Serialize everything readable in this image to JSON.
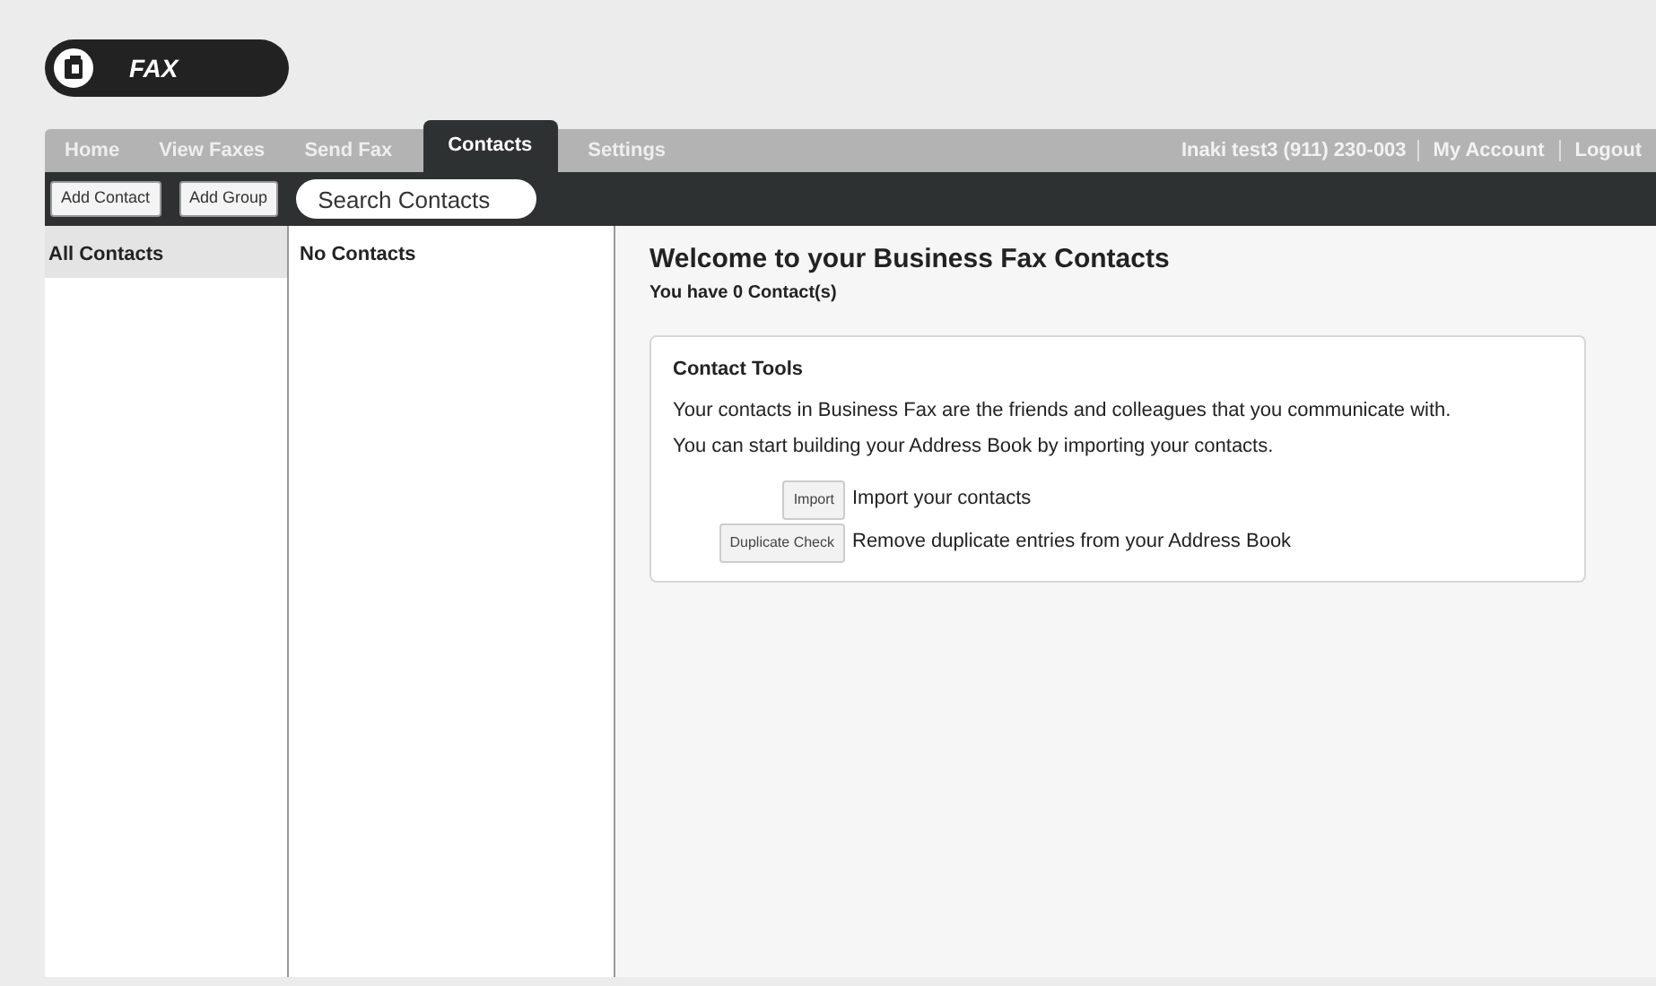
{
  "logo": {
    "text": "FAX"
  },
  "tabs": [
    {
      "label": "Home",
      "selected": false
    },
    {
      "label": "View Faxes",
      "selected": false
    },
    {
      "label": "Send Fax",
      "selected": false
    },
    {
      "label": "Contacts",
      "selected": true
    },
    {
      "label": "Settings",
      "selected": false
    }
  ],
  "user": {
    "name": "Inaki test3  (911) 230-003",
    "links": [
      "My Account",
      "Logout"
    ]
  },
  "toolbar": {
    "buttons": [
      "Add Contact",
      "Add Group"
    ],
    "search": {
      "placeholder": "Search Contacts"
    }
  },
  "groups": [
    {
      "label": "All Contacts",
      "selected": true
    }
  ],
  "contacts_list": {
    "empty_text": "No Contacts"
  },
  "welcome": {
    "title": "Welcome to your Business Fax Contacts",
    "count": "You have 0 Contact(s)"
  },
  "tools_card": {
    "title": "Contact Tools",
    "lines": [
      "Your contacts in Business Fax are the friends and colleagues that you communicate with.",
      "You can start building your Address Book by importing your contacts."
    ],
    "tools": [
      {
        "button": "Import",
        "description": "Import your contacts"
      },
      {
        "button": "Duplicate Check",
        "description": "Remove duplicate entries from your Address Book"
      }
    ]
  }
}
